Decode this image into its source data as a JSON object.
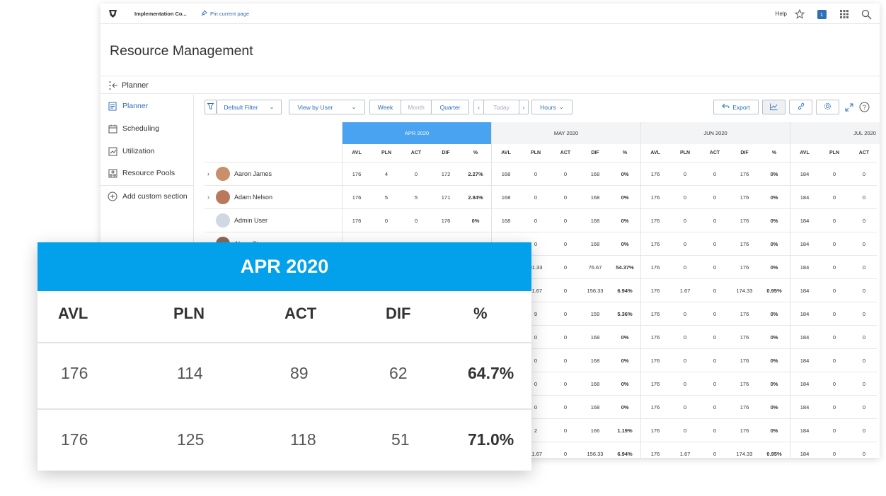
{
  "topbar": {
    "app_title": "Implementation Co...",
    "pin_label": "Pin current page",
    "help_label": "Help",
    "notification_count": "1"
  },
  "page": {
    "title": "Resource Management"
  },
  "planner_bar": {
    "label": "Planner"
  },
  "sidebar": {
    "items": [
      {
        "label": "Planner",
        "icon": "planner-icon",
        "active": true
      },
      {
        "label": "Scheduling",
        "icon": "calendar-icon",
        "active": false
      },
      {
        "label": "Utilization",
        "icon": "chart-icon",
        "active": false
      },
      {
        "label": "Resource Pools",
        "icon": "pools-icon",
        "active": false
      },
      {
        "label": "Add custom section",
        "icon": "add-circle-icon",
        "active": false
      }
    ]
  },
  "toolbar": {
    "filter_label": "Default Filter",
    "view_label": "View by User",
    "week_label": "Week",
    "month_label": "Month",
    "quarter_label": "Quarter",
    "today_label": "Today",
    "hours_label": "Hours",
    "export_label": "Export"
  },
  "grid": {
    "months": [
      "APR 2020",
      "MAY 2020",
      "JUN 2020",
      "JUL 2020"
    ],
    "columns": [
      "AVL",
      "PLN",
      "ACT",
      "DIF",
      "%"
    ],
    "users": [
      {
        "name": "Aaron James",
        "expandable": true
      },
      {
        "name": "Adam Nelson",
        "expandable": true
      },
      {
        "name": "Admin User",
        "expandable": false
      },
      {
        "name": "Alana Stevens",
        "expandable": true
      }
    ],
    "rows": [
      {
        "apr": [
          "176",
          "4",
          "0",
          "172",
          "2.27%"
        ],
        "may": [
          "168",
          "0",
          "0",
          "168",
          "0%"
        ],
        "jun": [
          "176",
          "0",
          "0",
          "176",
          "0%"
        ],
        "jul": [
          "184",
          "0",
          "0"
        ]
      },
      {
        "apr": [
          "176",
          "5",
          "5",
          "171",
          "2.84%"
        ],
        "may": [
          "168",
          "0",
          "0",
          "168",
          "0%"
        ],
        "jun": [
          "176",
          "0",
          "0",
          "176",
          "0%"
        ],
        "jul": [
          "184",
          "0",
          "0"
        ]
      },
      {
        "apr": [
          "176",
          "0",
          "0",
          "176",
          "0%"
        ],
        "may": [
          "168",
          "0",
          "0",
          "168",
          "0%"
        ],
        "jun": [
          "176",
          "0",
          "0",
          "176",
          "0%"
        ],
        "jul": [
          "184",
          "0",
          "0"
        ]
      },
      {
        "apr": [
          "176",
          "0",
          "0",
          "176",
          "0%"
        ],
        "may": [
          "168",
          "0",
          "0",
          "168",
          "0%"
        ],
        "jun": [
          "176",
          "0",
          "0",
          "176",
          "0%"
        ],
        "jul": [
          "184",
          "0",
          "0"
        ]
      },
      {
        "may": [
          "91.33",
          "0",
          "76.67",
          "54.37%"
        ],
        "jun": [
          "176",
          "0",
          "0",
          "176",
          "0%"
        ],
        "jul": [
          "184",
          "0",
          "0"
        ]
      },
      {
        "may": [
          "11.67",
          "0",
          "156.33",
          "6.94%"
        ],
        "jun": [
          "176",
          "1.67",
          "0",
          "174.33",
          "0.95%"
        ],
        "jul": [
          "184",
          "0",
          "0"
        ]
      },
      {
        "may": [
          "9",
          "0",
          "159",
          "5.36%"
        ],
        "jun": [
          "176",
          "0",
          "0",
          "176",
          "0%"
        ],
        "jul": [
          "184",
          "0",
          "0"
        ]
      },
      {
        "may": [
          "0",
          "0",
          "168",
          "0%"
        ],
        "jun": [
          "176",
          "0",
          "0",
          "176",
          "0%"
        ],
        "jul": [
          "184",
          "0",
          "0"
        ]
      },
      {
        "may": [
          "0",
          "0",
          "168",
          "0%"
        ],
        "jun": [
          "176",
          "0",
          "0",
          "176",
          "0%"
        ],
        "jul": [
          "184",
          "0",
          "0"
        ]
      },
      {
        "may": [
          "0",
          "0",
          "168",
          "0%"
        ],
        "jun": [
          "176",
          "0",
          "0",
          "176",
          "0%"
        ],
        "jul": [
          "184",
          "0",
          "0"
        ]
      },
      {
        "may": [
          "0",
          "0",
          "168",
          "0%"
        ],
        "jun": [
          "176",
          "0",
          "0",
          "176",
          "0%"
        ],
        "jul": [
          "184",
          "0",
          "0"
        ]
      },
      {
        "may": [
          "2",
          "0",
          "166",
          "1.19%"
        ],
        "jun": [
          "176",
          "0",
          "0",
          "176",
          "0%"
        ],
        "jul": [
          "184",
          "0",
          "0"
        ]
      },
      {
        "may": [
          "11.67",
          "0",
          "156.33",
          "6.94%"
        ],
        "jun": [
          "176",
          "1.67",
          "0",
          "174.33",
          "0.95%"
        ],
        "jul": [
          "184",
          "0",
          "0"
        ]
      }
    ]
  },
  "zoom": {
    "month": "APR 2020",
    "columns": [
      "AVL",
      "PLN",
      "ACT",
      "DIF",
      "%"
    ],
    "rows": [
      [
        "176",
        "114",
        "89",
        "62",
        "64.7%"
      ],
      [
        "176",
        "125",
        "118",
        "51",
        "71.0%"
      ]
    ]
  },
  "colors": {
    "accent": "#2f6fb7",
    "active_month": "#4aa3f0",
    "zoom_header": "#03a0ec"
  }
}
